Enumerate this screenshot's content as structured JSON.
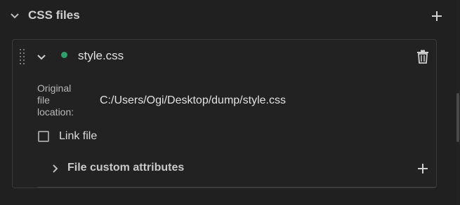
{
  "section": {
    "title": "CSS files",
    "collapse_icon": "chevron-down-icon",
    "add_icon": "plus-icon"
  },
  "file": {
    "name": "style.css",
    "status_color": "#2e9e6a",
    "location_label": "Original file location:",
    "location_value": "C:/Users/Ogi/Desktop/dump/style.css",
    "link_label": "Link file",
    "link_checked": false,
    "custom_attributes_label": "File custom attributes",
    "icons": {
      "drag": "drag-handle-icon",
      "collapse": "chevron-down-icon",
      "delete": "trash-icon",
      "expand_attributes": "chevron-right-icon",
      "add_attribute": "plus-icon"
    }
  },
  "colors": {
    "background": "#202020",
    "card_border": "#3a3a3a",
    "text": "#e2e2e2",
    "muted_text": "#b9b9b9"
  }
}
